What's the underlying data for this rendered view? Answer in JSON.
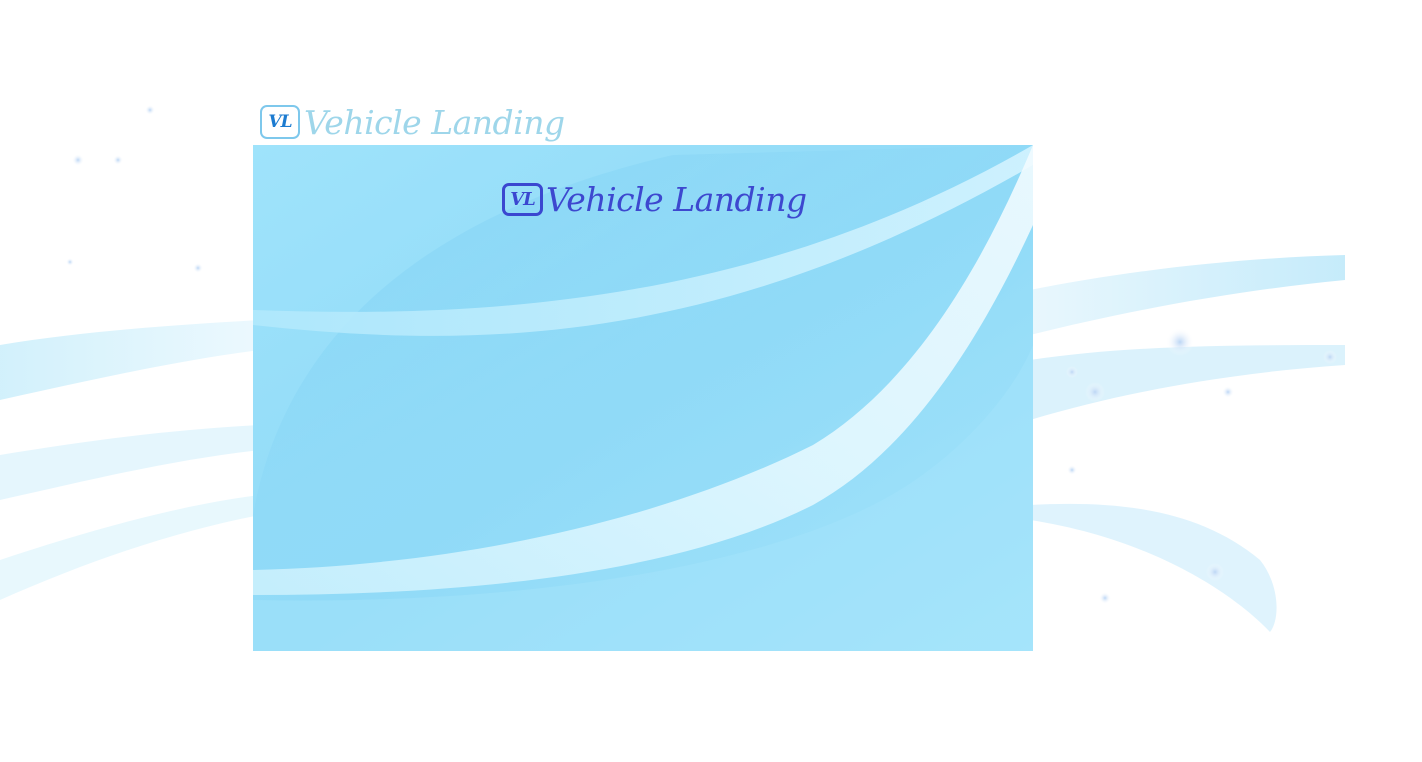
{
  "header": {
    "badge": "VL",
    "brand": "Vehicle Landing"
  },
  "panel": {
    "badge": "VL",
    "brand": "Vehicle Landing"
  },
  "colors": {
    "header_brand": "#9ed6ea",
    "panel_background": "#8fdaf7",
    "panel_brand": "#3d48cf"
  }
}
